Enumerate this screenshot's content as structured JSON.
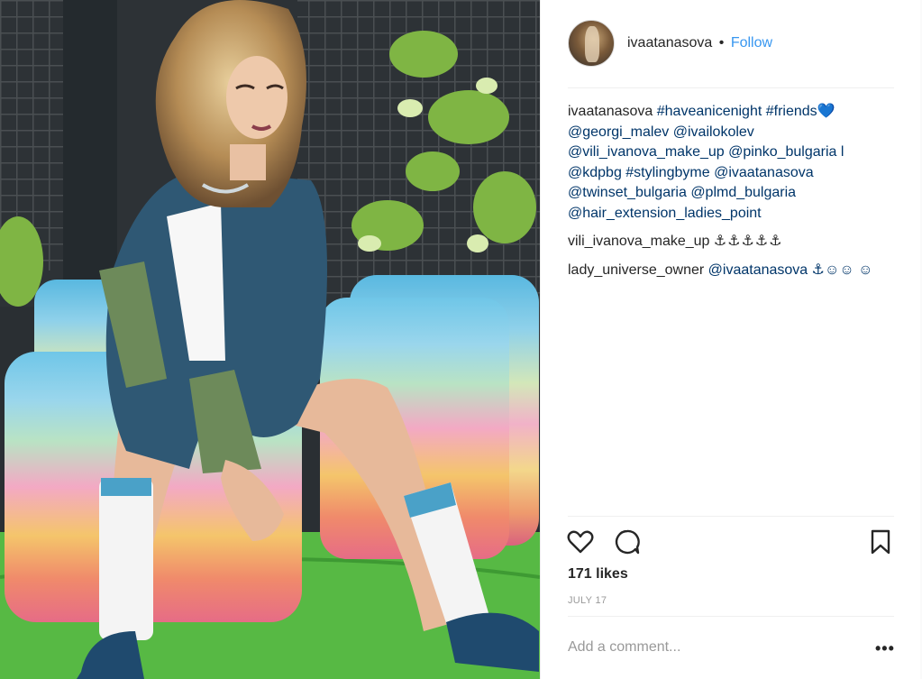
{
  "post": {
    "username": "ivaatanasova",
    "separator": "•",
    "follow_label": "Follow"
  },
  "comments": [
    {
      "author": "ivaatanasova",
      "text": "#haveanicenight #friends💙 @georgi_malev @ivailokolev @vili_ivanova_make_up @pinko_bulgaria l @kdpbg #stylingbyme @ivaatanasova @twinset_bulgaria @plmd_bulgaria @hair_extension_ladies_point"
    },
    {
      "author": "vili_ivanova_make_up",
      "text": "⚓⚓⚓⚓⚓"
    },
    {
      "author": "lady_universe_owner",
      "text": "@ivaatanasova ⚓☺☺ ☺"
    }
  ],
  "footer": {
    "likes": "171 likes",
    "date": "JULY 17",
    "comment_placeholder": "Add a comment...",
    "more_label": "•••"
  },
  "icons": [
    "heart-icon",
    "comment-icon",
    "bookmark-icon",
    "more-options-icon"
  ],
  "colors": {
    "follow": "#3897f0",
    "mention": "#003569",
    "muted": "#999999",
    "text": "#262626"
  }
}
